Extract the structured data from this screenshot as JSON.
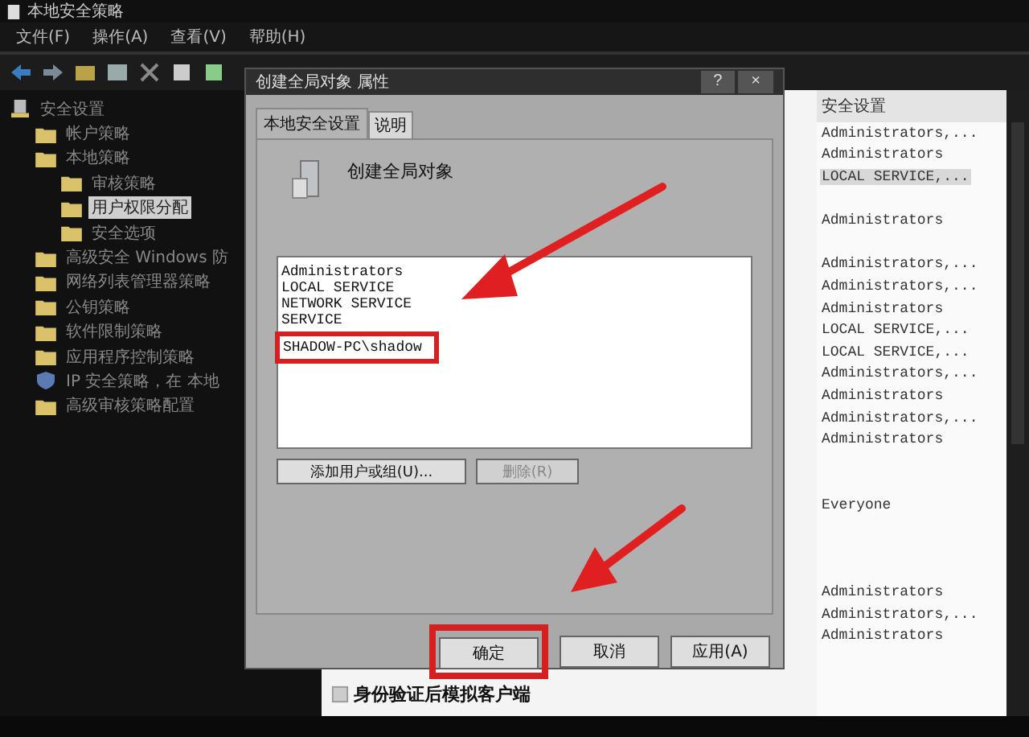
{
  "window": {
    "title": "本地安全策略"
  },
  "menu": [
    "文件(F)",
    "操作(A)",
    "查看(V)",
    "帮助(H)"
  ],
  "tree": [
    {
      "label": "安全设置",
      "kind": "root",
      "selected": false,
      "children": [
        {
          "label": "帐户策略",
          "kind": "folder",
          "selected": false
        },
        {
          "label": "本地策略",
          "kind": "folder",
          "selected": false,
          "children": [
            {
              "label": "审核策略",
              "kind": "folder",
              "selected": false
            },
            {
              "label": "用户权限分配",
              "kind": "folder",
              "selected": true
            },
            {
              "label": "安全选项",
              "kind": "folder",
              "selected": false
            }
          ]
        },
        {
          "label": "高级安全 Windows 防",
          "kind": "folder",
          "selected": false
        },
        {
          "label": "网络列表管理器策略",
          "kind": "folder",
          "selected": false
        },
        {
          "label": "公钥策略",
          "kind": "folder",
          "selected": false
        },
        {
          "label": "软件限制策略",
          "kind": "folder",
          "selected": false
        },
        {
          "label": "应用程序控制策略",
          "kind": "folder",
          "selected": false
        },
        {
          "label": "IP 安全策略，在 本地",
          "kind": "ipsec",
          "selected": false
        },
        {
          "label": "高级审核策略配置",
          "kind": "folder",
          "selected": false
        }
      ]
    }
  ],
  "policy_list": {
    "rows": [
      {
        "name": "身份验证后模拟客户端"
      }
    ]
  },
  "settings_column": {
    "header": "安全设置",
    "rows": [
      {
        "kind": "value",
        "value": "Administrators,...",
        "selected": false
      },
      {
        "kind": "value",
        "value": "Administrators",
        "selected": false
      },
      {
        "kind": "value",
        "value": "LOCAL SERVICE,...",
        "selected": true
      },
      {
        "kind": "blank"
      },
      {
        "kind": "value",
        "value": "Administrators",
        "selected": false
      },
      {
        "kind": "blank"
      },
      {
        "kind": "value",
        "value": "Administrators,...",
        "selected": false
      },
      {
        "kind": "value",
        "value": "Administrators,...",
        "selected": false
      },
      {
        "kind": "value",
        "value": "Administrators",
        "selected": false
      },
      {
        "kind": "value",
        "value": "LOCAL SERVICE,...",
        "selected": false
      },
      {
        "kind": "value",
        "value": "LOCAL SERVICE,...",
        "selected": false
      },
      {
        "kind": "value",
        "value": "Administrators,...",
        "selected": false
      },
      {
        "kind": "value",
        "value": "Administrators",
        "selected": false
      },
      {
        "kind": "value",
        "value": "Administrators,...",
        "selected": false
      },
      {
        "kind": "value",
        "value": "Administrators",
        "selected": false
      },
      {
        "kind": "blank"
      },
      {
        "kind": "blank"
      },
      {
        "kind": "value",
        "value": "Everyone",
        "selected": false
      },
      {
        "kind": "blank"
      },
      {
        "kind": "blank"
      },
      {
        "kind": "blank"
      },
      {
        "kind": "value",
        "value": "Administrators",
        "selected": false
      },
      {
        "kind": "value",
        "value": "Administrators,...",
        "selected": false
      },
      {
        "kind": "value",
        "value": "Administrators",
        "selected": false
      }
    ]
  },
  "dialog": {
    "title": "创建全局对象 属性",
    "title_buttons": [
      "?",
      "×"
    ],
    "tabs": [
      {
        "label": "本地安全设置",
        "selected": true
      },
      {
        "label": "说明",
        "selected": false
      }
    ],
    "policy_name": "创建全局对象",
    "accounts": [
      {
        "name": "Administrators",
        "highlighted": false
      },
      {
        "name": "LOCAL SERVICE",
        "highlighted": false
      },
      {
        "name": "NETWORK SERVICE",
        "highlighted": false
      },
      {
        "name": "SERVICE",
        "highlighted": false
      },
      {
        "name": "SHADOW-PC\\shadow",
        "highlighted": true
      }
    ],
    "list_buttons": [
      {
        "label": "添加用户或组(U)...",
        "disabled": false
      },
      {
        "label": "删除(R)",
        "disabled": true
      }
    ],
    "buttons": [
      {
        "label": "确定",
        "highlighted": true
      },
      {
        "label": "取消",
        "highlighted": false
      },
      {
        "label": "应用(A)",
        "highlighted": false
      }
    ]
  }
}
